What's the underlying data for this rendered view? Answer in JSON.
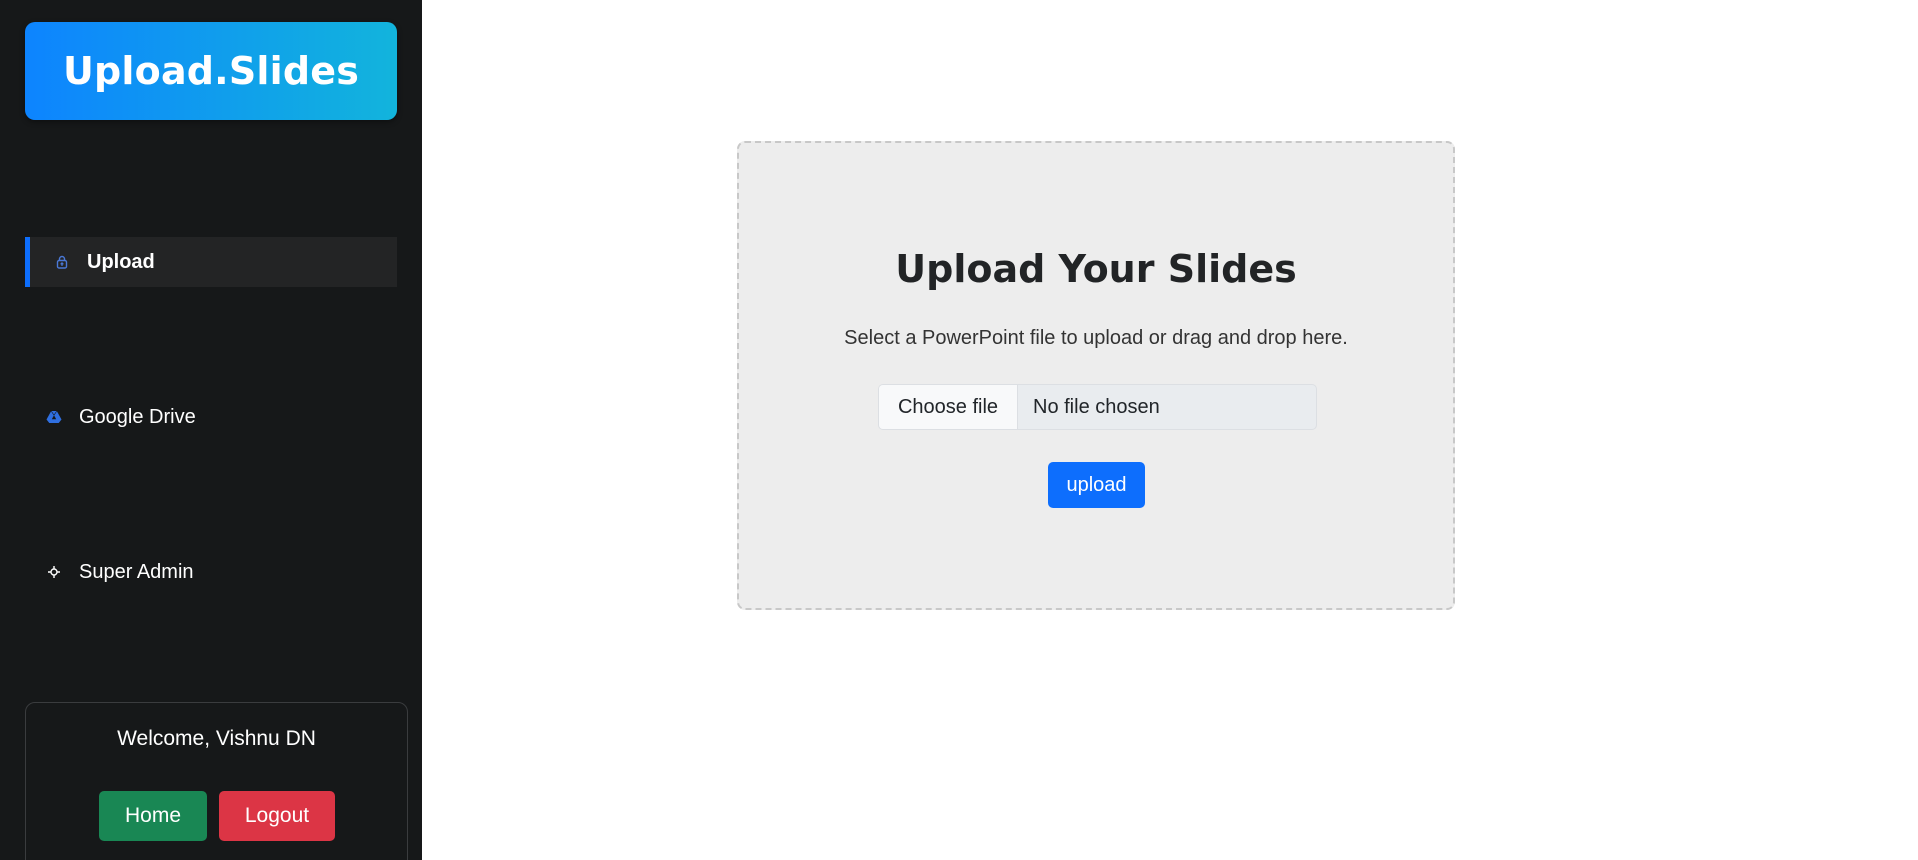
{
  "sidebar": {
    "brand": "Upload.Slides",
    "nav": [
      {
        "label": "Upload",
        "icon": "upload-icon",
        "active": true
      },
      {
        "label": "Google Drive",
        "icon": "google-drive-icon",
        "active": false
      },
      {
        "label": "Super Admin",
        "icon": "admin-icon",
        "active": false
      }
    ],
    "user": {
      "welcome": "Welcome, Vishnu DN",
      "home_label": "Home",
      "logout_label": "Logout"
    }
  },
  "main": {
    "title": "Upload Your Slides",
    "description": "Select a PowerPoint file to upload or drag and drop here.",
    "file_input": {
      "button_label": "Choose file",
      "status": "No file chosen"
    },
    "upload_label": "upload"
  },
  "colors": {
    "sidebar_bg": "#161819",
    "brand_gradient_start": "#0d84ff",
    "brand_gradient_end": "#12b4dc",
    "primary": "#0d6efd",
    "success": "#198754",
    "danger": "#dc3545"
  }
}
